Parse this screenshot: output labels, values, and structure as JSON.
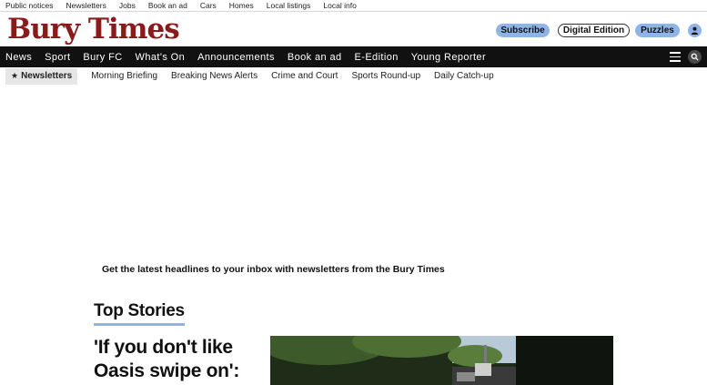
{
  "utility_links": [
    "Public notices",
    "Newsletters",
    "Jobs",
    "Book an ad",
    "Cars",
    "Homes",
    "Local listings",
    "Local info"
  ],
  "brand": {
    "logo_text": "Bury Times",
    "logo_color": "#8b1a1a",
    "accent": "#8fb4e6"
  },
  "header_buttons": {
    "subscribe": "Subscribe",
    "digital_edition": "Digital Edition",
    "puzzles": "Puzzles",
    "account_icon": "user-icon"
  },
  "main_nav": [
    "News",
    "Sport",
    "Bury FC",
    "What's On",
    "Announcements",
    "Book an ad",
    "E-Edition",
    "Young Reporter"
  ],
  "main_nav_icons": {
    "menu": "hamburger-icon",
    "search": "search-icon"
  },
  "sub_nav": {
    "active": "Newsletters",
    "items": [
      "Morning Briefing",
      "Breaking News Alerts",
      "Crime and Court",
      "Sports Round-up",
      "Daily Catch-up"
    ]
  },
  "promo_text": "Get the latest headlines to your inbox with newsletters from the Bury Times",
  "top_stories": {
    "title": "Top Stories",
    "lead_headline": "'If you don't like Oasis swipe on':"
  }
}
